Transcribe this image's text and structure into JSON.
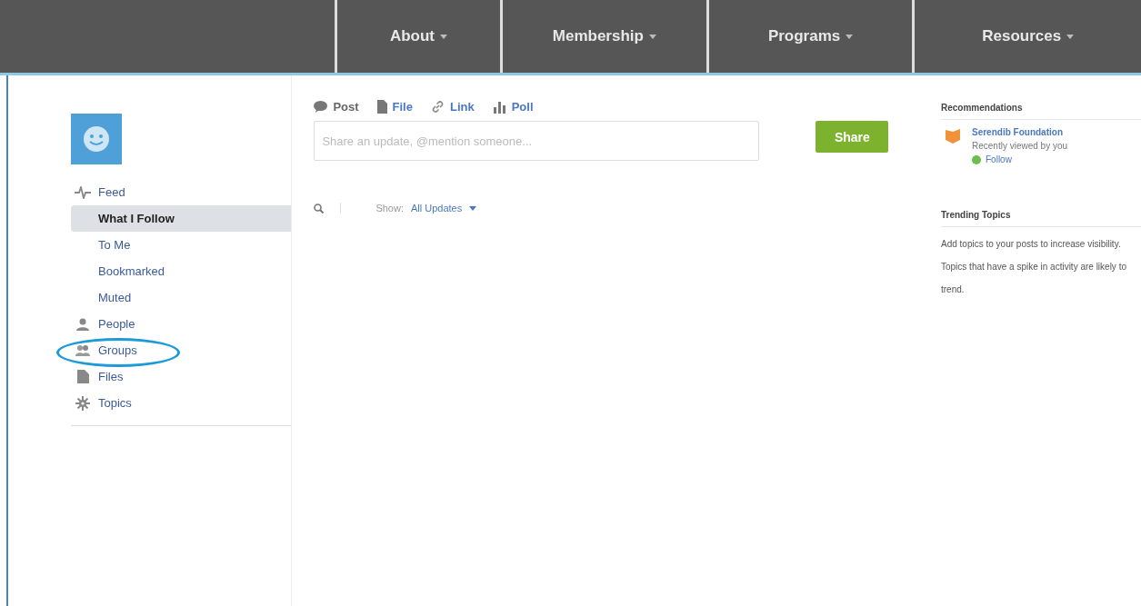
{
  "nav": {
    "items": [
      {
        "label": "About"
      },
      {
        "label": "Membership"
      },
      {
        "label": "Programs"
      },
      {
        "label": "Resources"
      }
    ]
  },
  "sidebar": {
    "items": [
      {
        "label": "Feed",
        "selected": false,
        "circled": false,
        "children": [
          {
            "label": "What I Follow",
            "selected": true
          },
          {
            "label": "To Me",
            "selected": false
          },
          {
            "label": "Bookmarked",
            "selected": false
          },
          {
            "label": "Muted",
            "selected": false
          }
        ]
      },
      {
        "label": "People",
        "selected": false,
        "circled": false
      },
      {
        "label": "Groups",
        "selected": false,
        "circled": true
      },
      {
        "label": "Files",
        "selected": false,
        "circled": false
      },
      {
        "label": "Topics",
        "selected": false,
        "circled": false
      }
    ]
  },
  "composer": {
    "tabs": [
      {
        "label": "Post",
        "selected": true
      },
      {
        "label": "File",
        "selected": false
      },
      {
        "label": "Link",
        "selected": false
      },
      {
        "label": "Poll",
        "selected": false
      }
    ],
    "placeholder": "Share an update, @mention someone...",
    "share_button": "Share"
  },
  "filter": {
    "label": "Show:",
    "value": "All Updates"
  },
  "recommendations": {
    "title": "Recommendations",
    "items": [
      {
        "name": "Serendib Foundation",
        "note": "Recently viewed by you",
        "action": "Follow"
      }
    ]
  },
  "trending": {
    "title": "Trending Topics",
    "text": "Add topics to your posts to increase visibility. Topics that have a spike in activity are likely to trend."
  }
}
